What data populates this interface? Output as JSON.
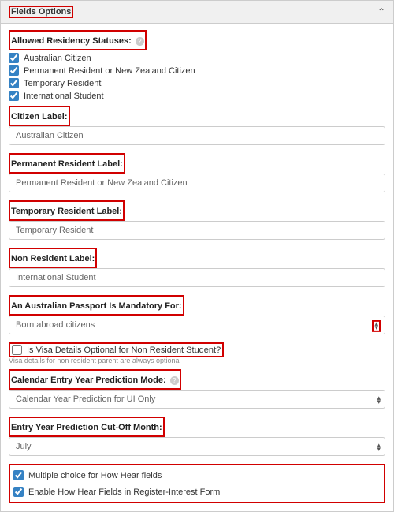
{
  "panel": {
    "title": "Fields Options"
  },
  "allowed_statuses": {
    "label": "Allowed Residency Statuses:",
    "items": [
      {
        "label": "Australian Citizen",
        "checked": true
      },
      {
        "label": "Permanent Resident or New Zealand Citizen",
        "checked": true
      },
      {
        "label": "Temporary Resident",
        "checked": true
      },
      {
        "label": "International Student",
        "checked": true
      }
    ]
  },
  "citizen_label": {
    "title": "Citizen Label:",
    "value": "Australian Citizen"
  },
  "permanent_label": {
    "title": "Permanent Resident Label:",
    "value": "Permanent Resident or New Zealand Citizen"
  },
  "temporary_label": {
    "title": "Temporary Resident Label:",
    "value": "Temporary Resident"
  },
  "nonresident_label": {
    "title": "Non Resident Label:",
    "value": "International Student"
  },
  "passport_mandatory": {
    "title": "An Australian Passport Is Mandatory For:",
    "value": "Born abroad citizens"
  },
  "visa_optional": {
    "label": "Is Visa Details Optional for Non Resident Student?",
    "checked": false,
    "hint": "Visa details for non resident parent are always optional"
  },
  "calendar_mode": {
    "title": "Calendar Entry Year Prediction Mode:",
    "value": "Calendar Year Prediction for UI Only"
  },
  "cutoff_month": {
    "title": "Entry Year Prediction Cut-Off Month:",
    "value": "July"
  },
  "howhear": {
    "multiple_label": "Multiple choice for How Hear fields",
    "multiple_checked": true,
    "enable_label": "Enable How Hear Fields in Register-Interest Form",
    "enable_checked": true
  }
}
